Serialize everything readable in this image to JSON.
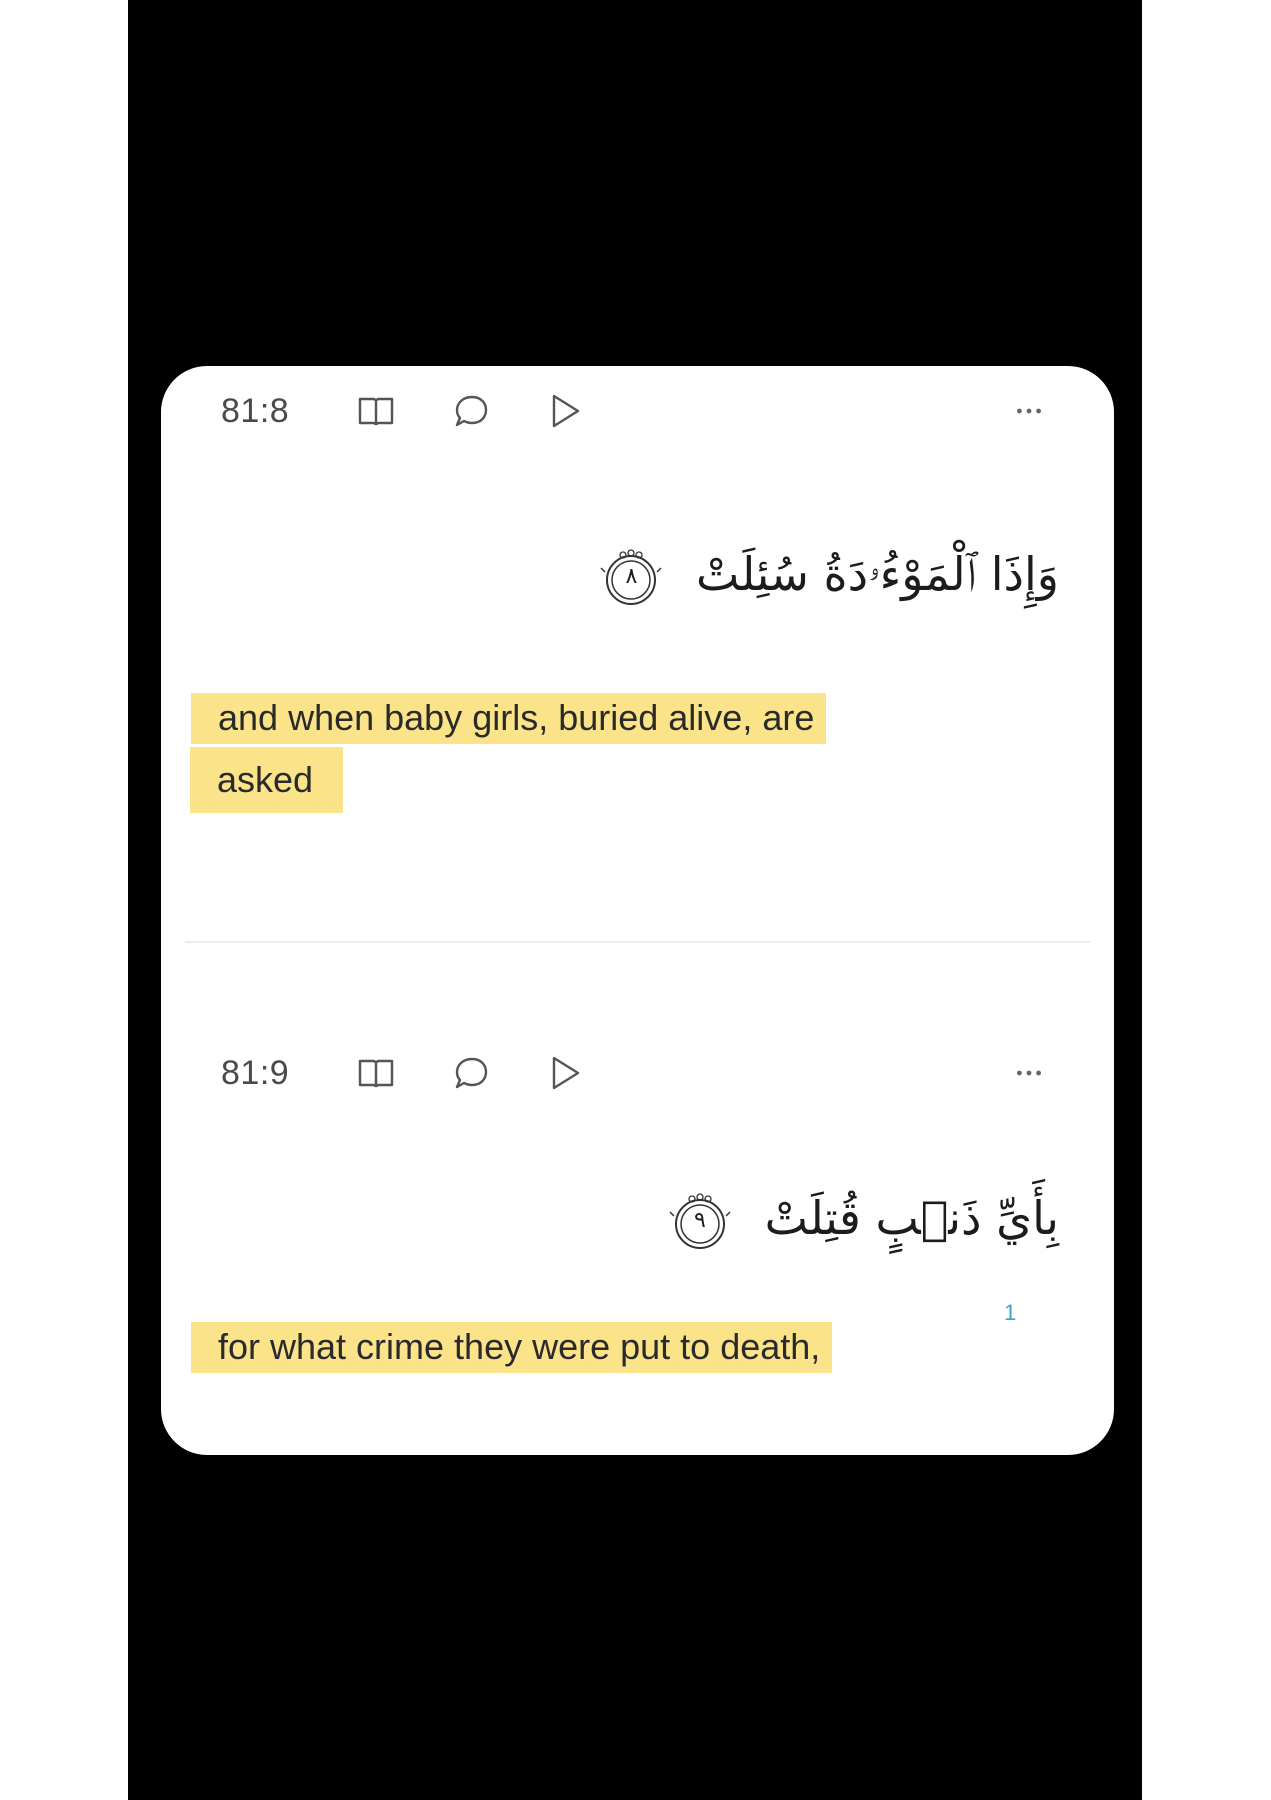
{
  "verses": [
    {
      "number": "81:8",
      "arabic": "وَإِذَا ٱلْمَوْءُۥدَةُ سُئِلَتْ",
      "ayah_marker": "٨",
      "translation_line1": "and when baby girls, buried alive, are",
      "translation_line2": "asked",
      "footnote": ""
    },
    {
      "number": "81:9",
      "arabic": "بِأَيِّ ذَنۢبٍ قُتِلَتْ",
      "ayah_marker": "٩",
      "translation_line1": "for what crime they were put to death,",
      "translation_line2": "",
      "footnote": "1"
    }
  ],
  "icons": {
    "book": "book-open-icon",
    "comment": "comment-icon",
    "play": "play-icon",
    "more": "more-dots-icon"
  },
  "colors": {
    "highlight": "#fbe38a",
    "footnote": "#3aa3c9",
    "frame": "#000000"
  }
}
